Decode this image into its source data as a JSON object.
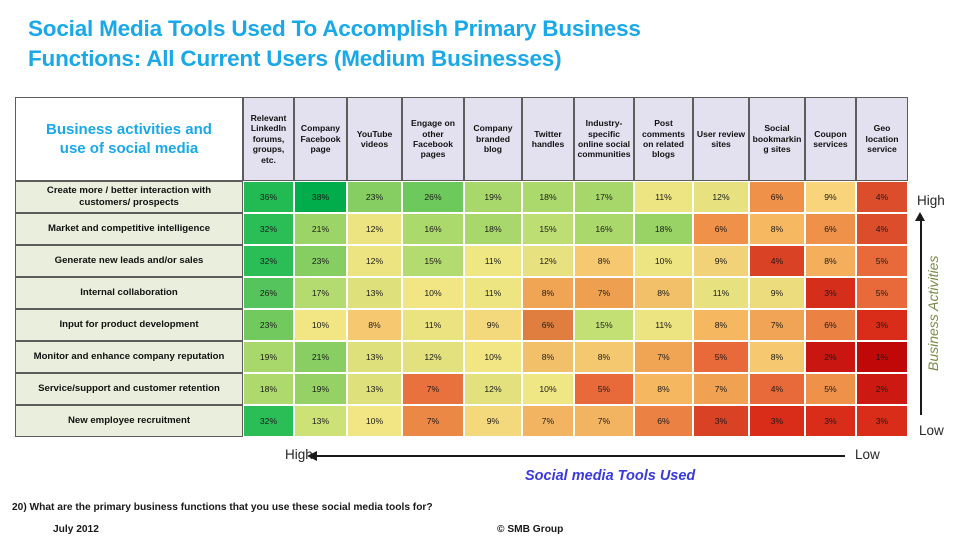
{
  "title": {
    "line1": "Social Media Tools Used To Accomplish Primary Business",
    "line2": "Functions: All Current Users (Medium Businesses)",
    "color": "#19a9e8"
  },
  "corner": {
    "line1": "Business activities and",
    "line2": "use of social media"
  },
  "axes": {
    "right_high": "High",
    "right_low": "Low",
    "right_label": "Business Activities",
    "bottom_high": "High",
    "bottom_low": "Low",
    "bottom_label": "Social media Tools Used",
    "bottom_label_color": "#3a3adc",
    "right_label_color": "#7b8b47"
  },
  "footer": {
    "question": "20) What are the primary business functions that you use these social media tools for?",
    "date": "July 2012",
    "credit": "© SMB Group"
  },
  "chart_data": {
    "type": "heatmap",
    "title": "Social Media Tools Used To Accomplish Primary Business Functions: All Current Users (Medium Businesses)",
    "xlabel": "Social media Tools Used",
    "ylabel": "Business Activities",
    "unit": "%",
    "categories": [
      "Relevant LinkedIn forums, groups, etc.",
      "Company Facebook page",
      "YouTube videos",
      "Engage on other Facebook pages",
      "Company branded blog",
      "Twitter handles",
      "Industry-specific online social communities",
      "Post comments on related blogs",
      "User review sites",
      "Social bookmarking sites",
      "Coupon services",
      "Geo location service"
    ],
    "rows": [
      "Create more / better interaction with customers/ prospects",
      "Market and competitive intelligence",
      "Generate new leads and/or sales",
      "Internal collaboration",
      "Input for product development",
      "Monitor and enhance company reputation",
      "Service/support and customer retention",
      "New employee recruitment"
    ],
    "values": [
      [
        36,
        38,
        23,
        26,
        19,
        18,
        17,
        11,
        12,
        6,
        9,
        4
      ],
      [
        32,
        21,
        12,
        16,
        18,
        15,
        16,
        18,
        6,
        8,
        6,
        4
      ],
      [
        32,
        23,
        12,
        15,
        11,
        12,
        8,
        10,
        9,
        4,
        8,
        5
      ],
      [
        26,
        17,
        13,
        10,
        11,
        8,
        7,
        8,
        11,
        9,
        3,
        5
      ],
      [
        23,
        10,
        8,
        11,
        9,
        6,
        15,
        11,
        8,
        7,
        6,
        3
      ],
      [
        19,
        21,
        13,
        12,
        10,
        8,
        8,
        7,
        5,
        8,
        2,
        1
      ],
      [
        18,
        19,
        13,
        7,
        12,
        10,
        5,
        8,
        7,
        4,
        5,
        2
      ],
      [
        32,
        13,
        10,
        7,
        9,
        7,
        7,
        6,
        3,
        3,
        3,
        3
      ]
    ],
    "cell_colors": [
      [
        "#21ba53",
        "#01ad4a",
        "#86cd62",
        "#6ec95c",
        "#a8d86b",
        "#abd96c",
        "#a7d76a",
        "#ede482",
        "#e7e17f",
        "#ef9149",
        "#fad47a",
        "#dc4d2c"
      ],
      [
        "#2bbd56",
        "#9cd467",
        "#ece381",
        "#abd96c",
        "#a8d86b",
        "#bcde72",
        "#aad86b",
        "#99d366",
        "#ef9149",
        "#f6b962",
        "#ef9149",
        "#dc4d2c"
      ],
      [
        "#2bbd56",
        "#86cd62",
        "#ece381",
        "#b4db6f",
        "#efe684",
        "#e7e17f",
        "#f6c86f",
        "#ede482",
        "#f2d278",
        "#da4226",
        "#f5ae5c",
        "#e8693a"
      ],
      [
        "#56c45c",
        "#b4db6f",
        "#dee07c",
        "#f1e584",
        "#ede482",
        "#f0a554",
        "#eea050",
        "#f3c06a",
        "#e7e17f",
        "#eddc7e",
        "#d52f1c",
        "#e8693a"
      ],
      [
        "#72ca5e",
        "#f1e584",
        "#f6c86f",
        "#ebe380",
        "#f3d97c",
        "#e07e3f",
        "#c3e074",
        "#ece381",
        "#f5b760",
        "#f1a455",
        "#eb8143",
        "#d92d1a"
      ],
      [
        "#a8d86b",
        "#88ce63",
        "#dee07c",
        "#e3e17e",
        "#f1e584",
        "#f3c06a",
        "#f4c86f",
        "#f0a554",
        "#e8693a",
        "#f6c86f",
        "#c91610",
        "#c00808"
      ],
      [
        "#aed96d",
        "#95d165",
        "#dee07c",
        "#e8713d",
        "#e3e17e",
        "#efe684",
        "#e8693a",
        "#f5b760",
        "#f0a152",
        "#e8693a",
        "#ef9149",
        "#cc1a12"
      ],
      [
        "#2bbd56",
        "#cce277",
        "#f1e584",
        "#ec8846",
        "#f3d97c",
        "#f2b461",
        "#f2b461",
        "#eb8143",
        "#da4226",
        "#d92d1a",
        "#d92d1a",
        "#d92d1a"
      ]
    ]
  }
}
